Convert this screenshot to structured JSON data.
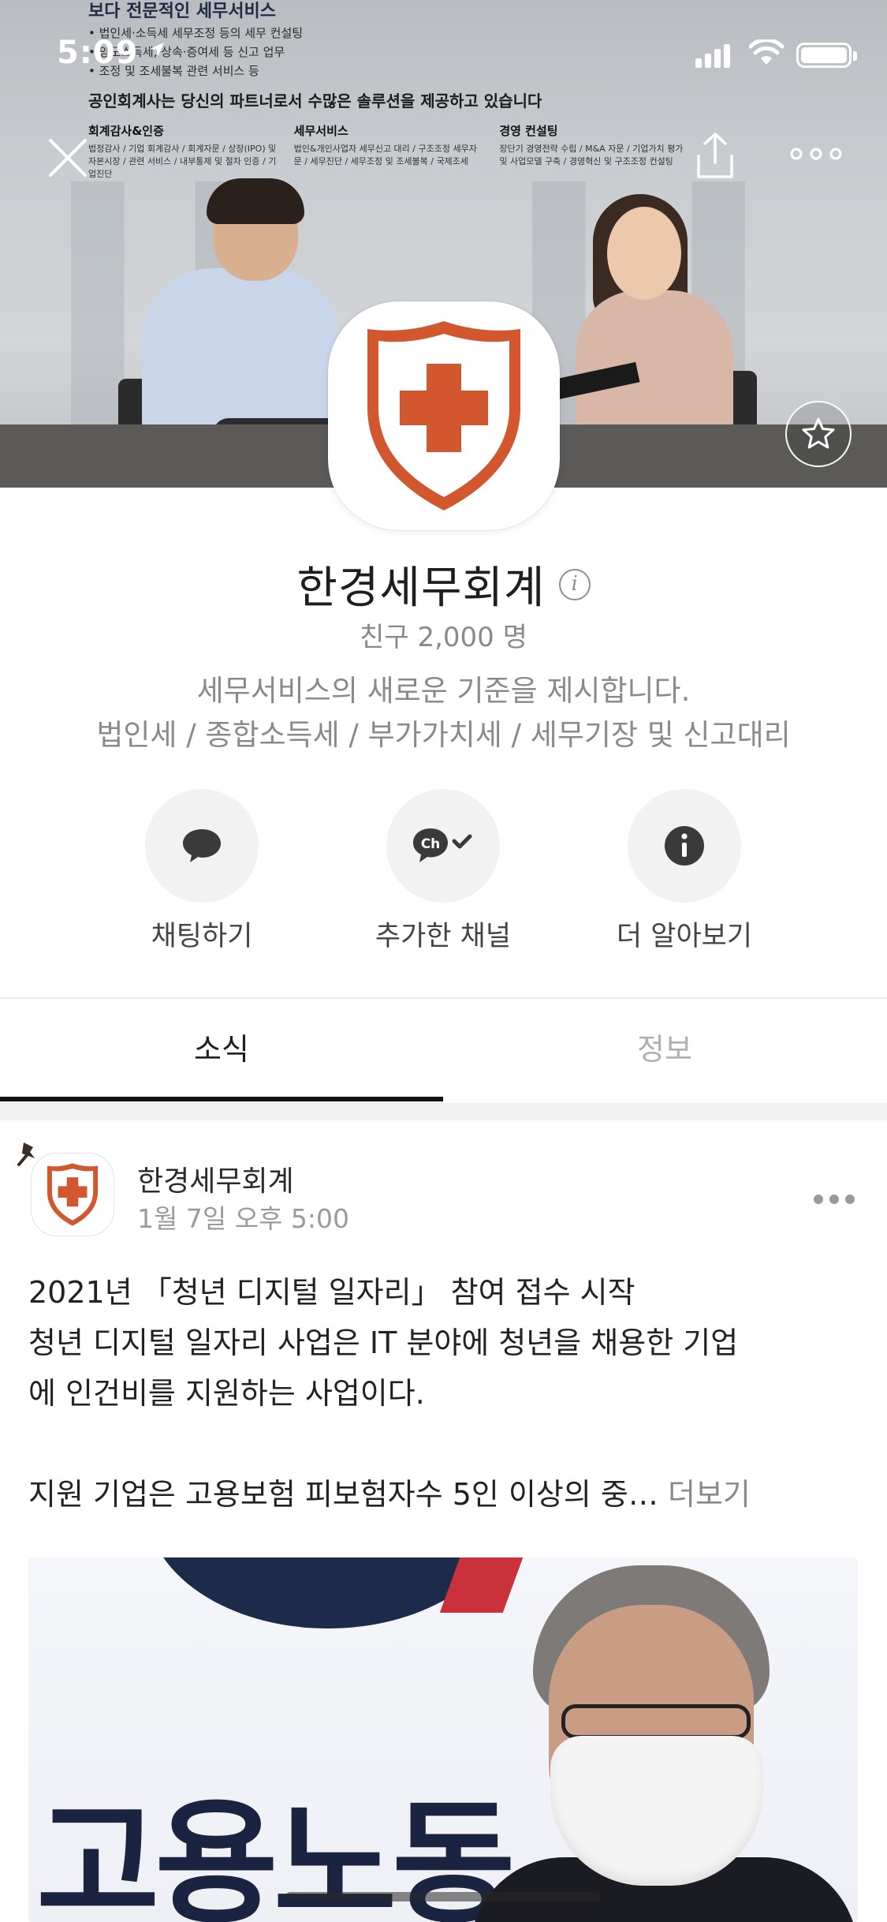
{
  "status_bar": {
    "time": "5:09"
  },
  "cover": {
    "headline": "보다 전문적인 세무서비스",
    "lines": [
      "• 법인세·소득세 세무조정 등의 세무 컨설팅",
      "• 양도소득세, 상속·증여세 등 신고 업무",
      "• 조정 및 조세불복 관련 서비스 등"
    ],
    "tagline": "공인회계사는 당신의 파트너로서 수많은 솔루션을 제공하고 있습니다",
    "columns": [
      {
        "title": "회계감사&인증",
        "text": "법정감사 / 기업 회계감사 / 회계자문 / 상장(IPO) 및 자본시장 / 관련 서비스 / 내부통제 및 절차 인증 / 기업진단"
      },
      {
        "title": "세무서비스",
        "text": "법인&개인사업자 세무신고 대리 / 구조조정 세무자문 / 세무진단 / 세무조정 및 조세불복 / 국제조세"
      },
      {
        "title": "경영 컨설팅",
        "text": "장단기 경영전략 수립 / M&A 자문 / 기업가치 평가 및 사업모델 구축 / 경영혁신 및 구조조정 컨설팅"
      }
    ]
  },
  "profile": {
    "name": "한경세무회계",
    "friends": "친구 2,000 명",
    "description_line1": "세무서비스의 새로운 기준을 제시합니다.",
    "description_line2": "법인세 / 종합소득세 / 부가가치세 / 세무기장 및 신고대리",
    "accent_color": "#d2572f"
  },
  "actions": [
    {
      "label": "채팅하기",
      "icon": "chat-bubble-icon"
    },
    {
      "label": "추가한 채널",
      "icon": "channel-added-icon",
      "badge": "Ch"
    },
    {
      "label": "더 알아보기",
      "icon": "info-icon"
    }
  ],
  "tabs": [
    {
      "label": "소식",
      "active": true
    },
    {
      "label": "정보",
      "active": false
    }
  ],
  "post": {
    "author": "한경세무회계",
    "time": "1월 7일 오후 5:00",
    "lines": [
      "2021년 「청년 디지털 일자리」 참여 접수 시작",
      "청년 디지털 일자리 사업은 IT 분야에 청년을 채용한 기업",
      "에 인건비를 지원하는 사업이다."
    ],
    "last_line": "지원 기업은 고용보험 피보험자수 5인 이상의 중…",
    "more_label": "더보기",
    "image_text": "고용노동"
  }
}
